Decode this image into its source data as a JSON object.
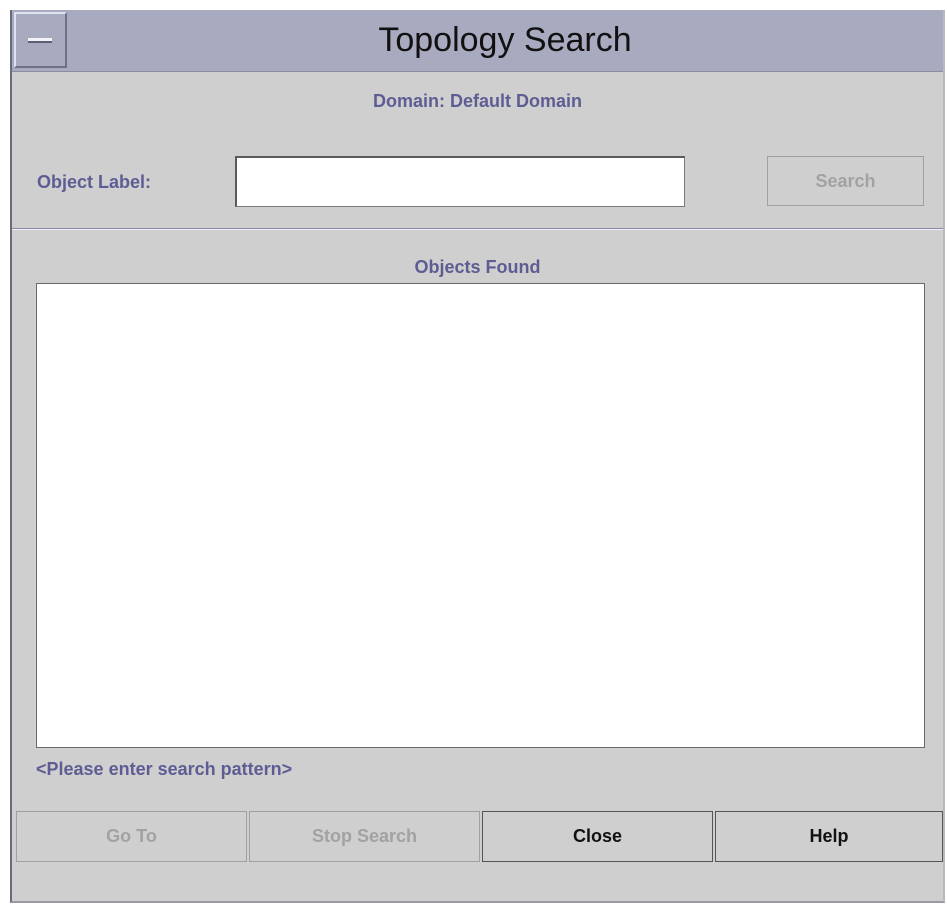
{
  "window": {
    "title": "Topology Search"
  },
  "header": {
    "domain_text": "Domain: Default Domain"
  },
  "search": {
    "label": "Object Label:",
    "value": "",
    "button_label": "Search"
  },
  "results": {
    "heading": "Objects Found",
    "items": []
  },
  "status": {
    "message": "<Please enter search pattern>"
  },
  "actions": {
    "goto_label": "Go To",
    "stop_label": "Stop Search",
    "close_label": "Close",
    "help_label": "Help"
  },
  "colors": {
    "titlebar": "#a8aabf",
    "window_bg": "#cfcfcf",
    "label_text": "#5d5d94",
    "disabled_text": "#a2a2a2"
  },
  "icons": {
    "window_menu": "window-menu-icon"
  }
}
